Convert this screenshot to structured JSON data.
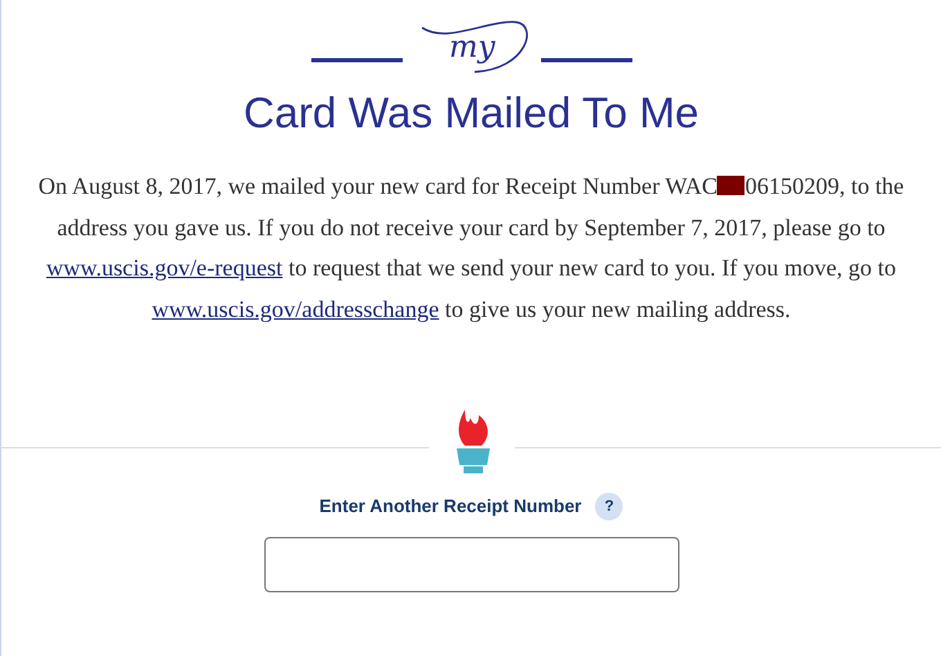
{
  "logo": {
    "text": "my"
  },
  "title": "Card Was Mailed To Me",
  "message": [
    {
      "kind": "text",
      "text": "On August 8, 2017, we mailed your new card for Receipt Number WAC"
    },
    {
      "kind": "redaction"
    },
    {
      "kind": "text",
      "text": "06150209, to the address you gave us. If you do not receive your card by September 7, 2017, please go to "
    },
    {
      "kind": "link",
      "text": "www.uscis.gov/e-request"
    },
    {
      "kind": "text",
      "text": " to request that we send your new card to you. If you move, go to "
    },
    {
      "kind": "link",
      "text": "www.uscis.gov/addresschange"
    },
    {
      "kind": "text",
      "text": " to give us your new mailing address."
    }
  ],
  "receipt_form": {
    "label": "Enter Another Receipt Number",
    "help": "?"
  }
}
